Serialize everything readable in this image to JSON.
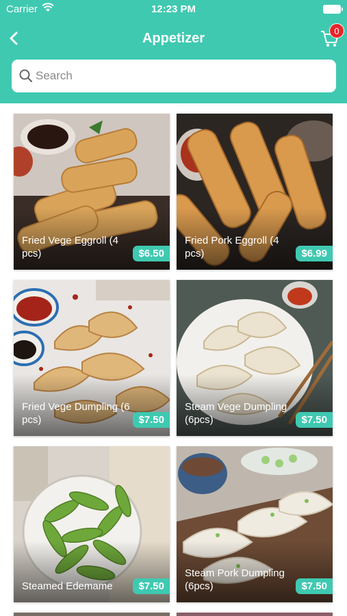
{
  "status_bar": {
    "carrier": "Carrier",
    "time": "12:23 PM"
  },
  "nav": {
    "title": "Appetizer",
    "cart_count": "0"
  },
  "search": {
    "placeholder": "Search"
  },
  "items": [
    {
      "name": "Fried Vege Eggroll (4 pcs)",
      "price": "$6.50",
      "image": "eggrolls-with-dipping-sauce"
    },
    {
      "name": "Fried Pork Eggroll (4 pcs)",
      "price": "$6.99",
      "image": "pork-eggrolls-with-chili-sauce"
    },
    {
      "name": "Fried Vege Dumpling (6 pcs)",
      "price": "$7.50",
      "image": "fried-dumplings-with-chili-oil"
    },
    {
      "name": "Steam Vege Dumpling (6pcs)",
      "price": "$7.50",
      "image": "steamed-dumplings-on-plate"
    },
    {
      "name": "Steamed Edemame",
      "price": "$7.50",
      "image": "edamame-in-bowl"
    },
    {
      "name": "Steam Pork Dumpling (6pcs)",
      "price": "$7.50",
      "image": "pork-dumplings-on-board"
    }
  ],
  "colors": {
    "brand": "#3fc9b1",
    "badge": "#e8262a"
  }
}
